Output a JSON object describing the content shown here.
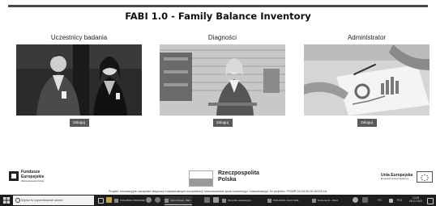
{
  "app": {
    "title": "FABI 1.0 - Family Balance Inventory"
  },
  "cards": [
    {
      "title": "Uczestnicy badania",
      "button": "Zaloguj"
    },
    {
      "title": "Diagności",
      "button": "Zaloguj"
    },
    {
      "title": "Administrator",
      "button": "Zaloguj"
    }
  ],
  "footer": {
    "fe_line1": "Fundusze",
    "fe_line2": "Europejskie",
    "fe_small": "Wiedza Edukacja Rozwój",
    "rp_line1": "Rzeczpospolita",
    "rp_line2": "Polska",
    "ue_line1": "Unia Europejska",
    "ue_small": "Europejski Fundusz Społeczny",
    "note": "Projekt: Innowacyjne narzędzie diagnozy indywidualnych kompetencji równoważenia życia rodzinnego i zawodowego, Nr projektu: POWR.04.03.00-00-W101/16."
  },
  "taskbar": {
    "search_placeholder": "Wpisz tu wyszukiwane słowo",
    "apps": [
      "POKAŻNIK WIDZIANE",
      "Admin Panel - Bac...",
      "Wszystko edukacyjne...",
      "POKAŻNIK CAŁKI WIE...",
      "Dokument1 - Word"
    ],
    "weather": "9°C",
    "lang": "POL",
    "time": "13:49",
    "date": "05.11.2021"
  },
  "colors": {
    "button_bg": "#5a5a5a",
    "taskbar_bg": "#1e1e1e",
    "title_line": "#4a4a4a"
  }
}
